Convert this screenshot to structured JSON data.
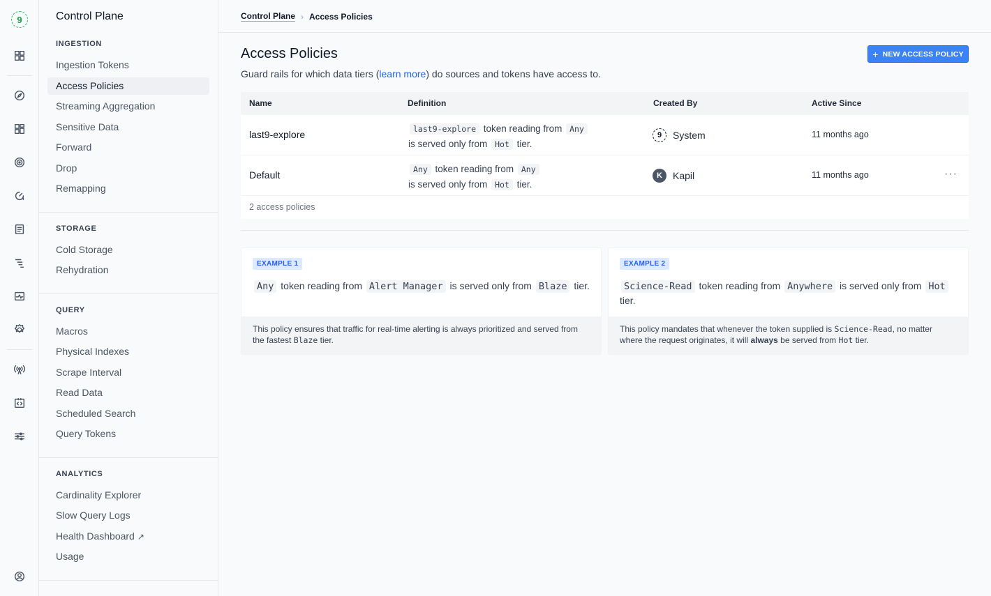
{
  "rail": {
    "logo_text": "9",
    "icons": [
      "dashboard-icon",
      "compass-icon",
      "grid-icon",
      "target-icon",
      "gauge-icon",
      "document-icon",
      "waterfall-icon",
      "pulse-icon",
      "settings-icon",
      "antenna-icon",
      "code-icon",
      "sliders-icon",
      "user-circle-icon"
    ]
  },
  "sidebar": {
    "title": "Control Plane",
    "sections": [
      {
        "heading": "INGESTION",
        "items": [
          "Ingestion Tokens",
          "Access Policies",
          "Streaming Aggregation",
          "Sensitive Data",
          "Forward",
          "Drop",
          "Remapping"
        ]
      },
      {
        "heading": "STORAGE",
        "items": [
          "Cold Storage",
          "Rehydration"
        ]
      },
      {
        "heading": "QUERY",
        "items": [
          "Macros",
          "Physical Indexes",
          "Scrape Interval",
          "Read Data",
          "Scheduled Search",
          "Query Tokens"
        ]
      },
      {
        "heading": "ANALYTICS",
        "items": [
          "Cardinality Explorer",
          "Slow Query Logs",
          "Health Dashboard",
          "Usage"
        ]
      }
    ],
    "active_item": "Access Policies",
    "external_glyph": "↗"
  },
  "header": {
    "breadcrumb_root": "Control Plane",
    "breadcrumb_sep": "›",
    "breadcrumb_current": "Access Policies"
  },
  "page": {
    "title": "Access Policies",
    "desc_prefix": "Guard rails for which data tiers (",
    "desc_link": "learn more",
    "desc_suffix": ") do sources and tokens have access to.",
    "new_button": "NEW ACCESS POLICY",
    "new_button_icon": "+"
  },
  "table": {
    "headers": {
      "name": "Name",
      "definition": "Definition",
      "created_by": "Created By",
      "active_since": "Active Since"
    },
    "rows": [
      {
        "name": "last9-explore",
        "token": "last9-explore",
        "reading_from": "token reading from",
        "source": "Any",
        "served": "is served only from",
        "tier": "Hot",
        "tier_suffix": "tier.",
        "creator": "System",
        "creator_avatar": "9",
        "since": "11 months ago"
      },
      {
        "name": "Default",
        "token": "Any",
        "reading_from": "token reading from",
        "source": "Any",
        "served": "is served only from",
        "tier": "Hot",
        "tier_suffix": "tier.",
        "creator": "Kapil",
        "creator_avatar": "K",
        "since": "11 months ago",
        "more": "···"
      }
    ],
    "footer": "2 access policies"
  },
  "examples": [
    {
      "badge": "EXAMPLE 1",
      "token": "Any",
      "t1": "token reading from",
      "source": "Alert Manager",
      "t2": "is served only from",
      "tier": "Blaze",
      "t3": "tier.",
      "note_a": "This policy ensures that traffic for real-time alerting is always prioritized and served from the fastest ",
      "note_code": "Blaze",
      "note_b": " tier."
    },
    {
      "badge": "EXAMPLE 2",
      "token": "Science-Read",
      "t1": "token reading from",
      "source": "Anywhere",
      "t2": "is served only from",
      "tier": "Hot",
      "t3": "tier.",
      "note_a": "This policy mandates that whenever the token supplied is ",
      "note_code": "Science-Read",
      "note_b": ", no matter where the request originates, it will ",
      "note_bold": "always",
      "note_c": " be served from ",
      "note_code2": "Hot",
      "note_d": " tier."
    }
  ],
  "colors": {
    "accent": "#3b82f6",
    "link": "#2563eb",
    "badge_bg": "#dbeafe",
    "logo_green": "#16a34a"
  }
}
